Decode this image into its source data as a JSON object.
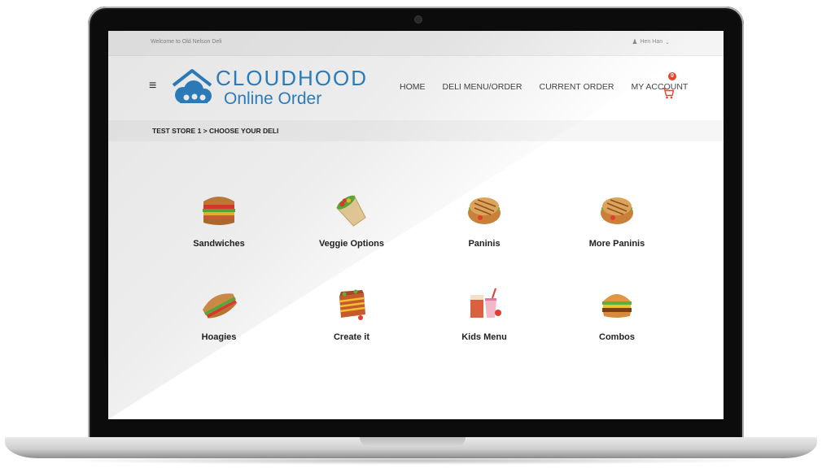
{
  "topbar": {
    "welcome": "Welcome to Old Nelson Deli",
    "user_name": "Hen Han",
    "user_caret": "⌄"
  },
  "brand": {
    "line1": "CLOUDHOOD",
    "line2": "Online Order",
    "color": "#2f86c9"
  },
  "nav": {
    "items": [
      "HOME",
      "DELI MENU/ORDER",
      "CURRENT ORDER",
      "MY ACCOUNT"
    ],
    "cart_count": "0",
    "menu_icon": "hamburger-icon",
    "cart_icon": "cart-icon"
  },
  "breadcrumb": "TEST STORE 1 > CHOOSE YOUR DELI",
  "categories": [
    {
      "label": "Sandwiches",
      "icon": "sandwich-icon"
    },
    {
      "label": "Veggie Options",
      "icon": "wrap-icon"
    },
    {
      "label": "Paninis",
      "icon": "panini-icon"
    },
    {
      "label": "More Paninis",
      "icon": "panini-icon"
    },
    {
      "label": "Hoagies",
      "icon": "hoagie-icon"
    },
    {
      "label": "Create it",
      "icon": "lasagna-icon"
    },
    {
      "label": "Kids Menu",
      "icon": "kids-meal-icon"
    },
    {
      "label": "Combos",
      "icon": "burger-icon"
    }
  ],
  "colors": {
    "accent": "#2f86c9",
    "badge": "#e8412c"
  }
}
